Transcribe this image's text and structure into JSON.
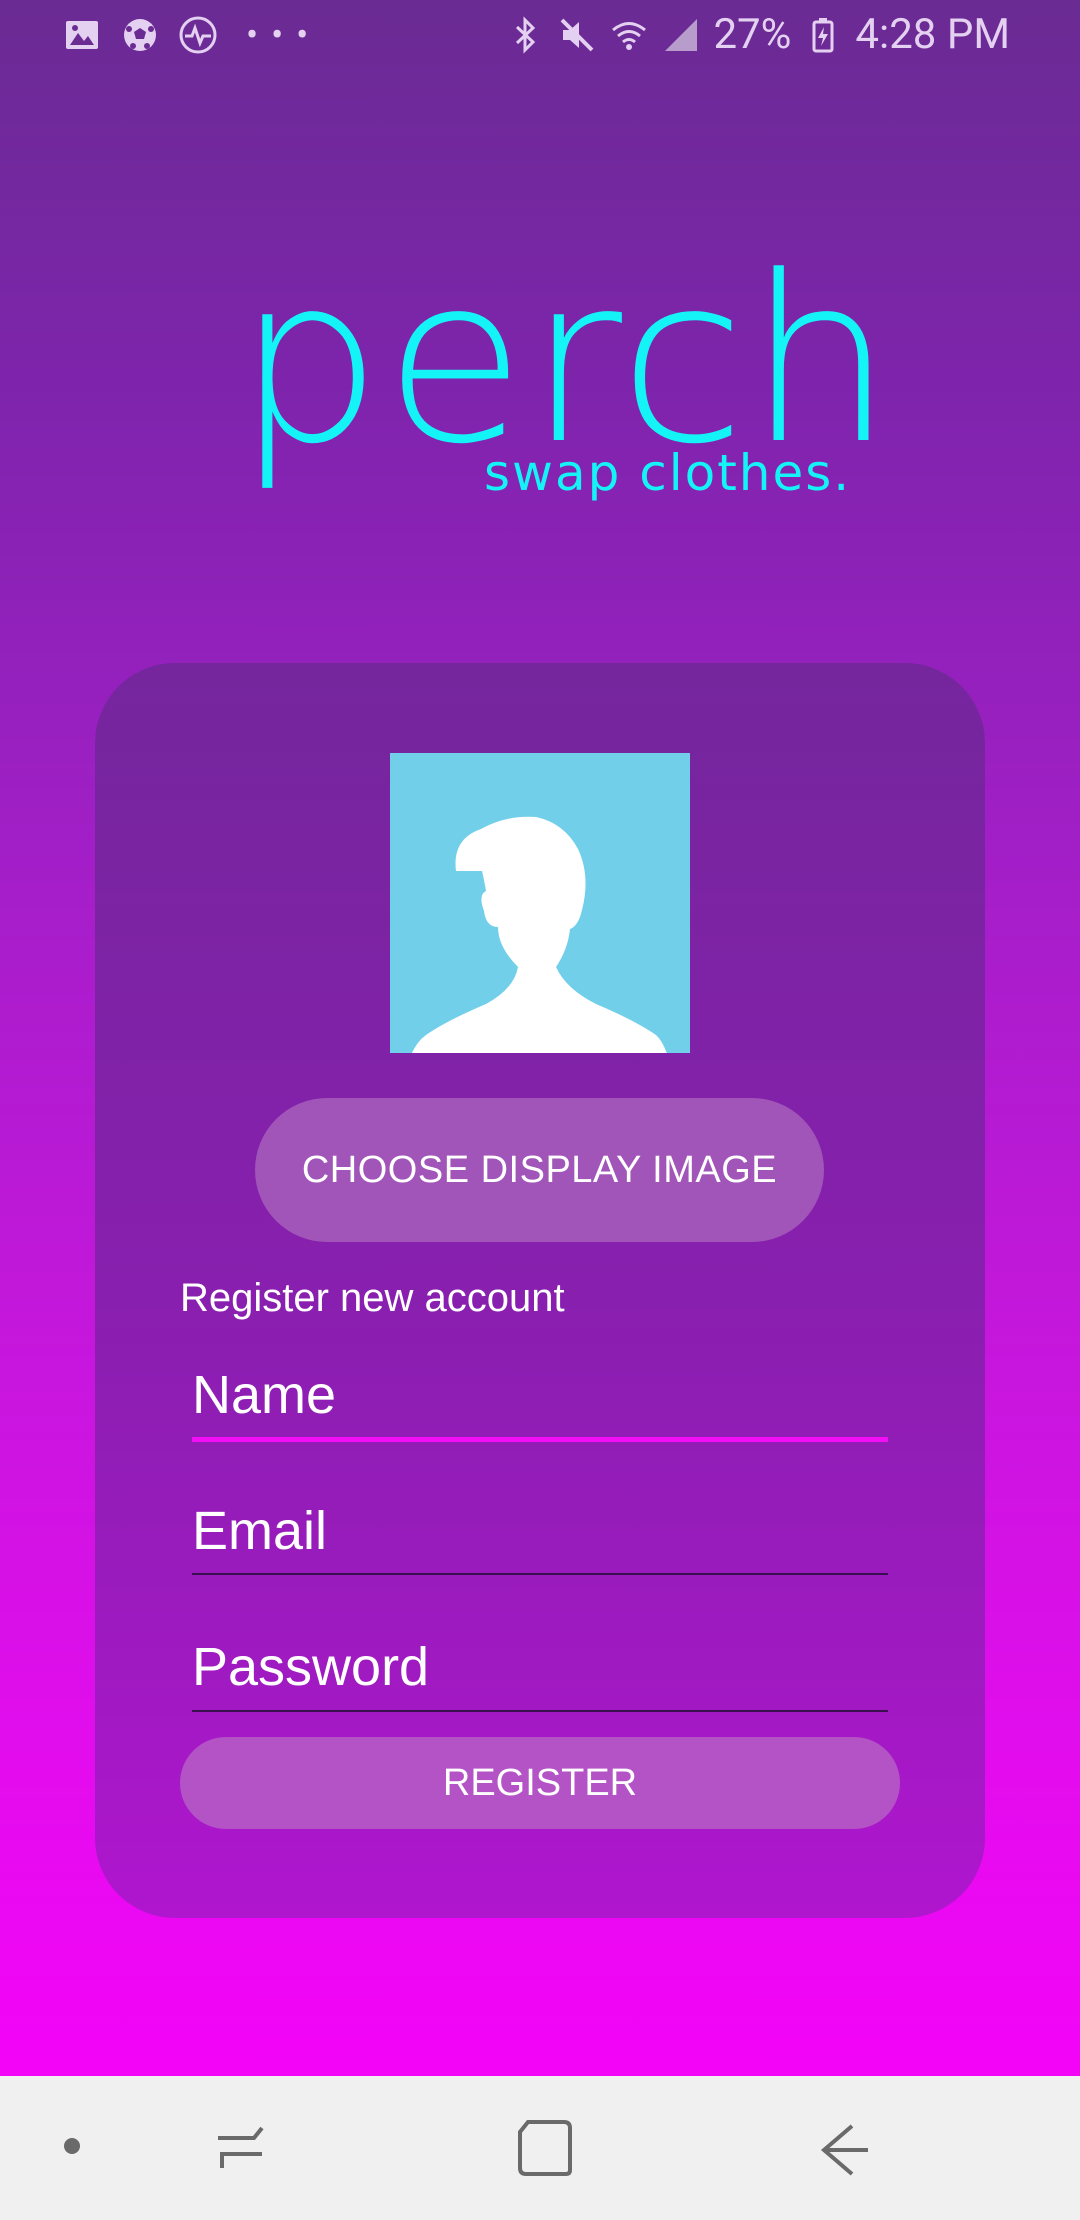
{
  "status_bar": {
    "battery": "27%",
    "time": "4:28 PM",
    "left_icons": [
      "gallery-icon",
      "soccer-ball-icon",
      "health-pulse-icon",
      "more-dots-icon"
    ],
    "right_icons": [
      "bluetooth-icon",
      "mute-icon",
      "wifi-icon",
      "signal-icon",
      "battery-icon"
    ]
  },
  "logo": {
    "word": "perch",
    "tagline": "swap clothes.",
    "color": "#14f4f7"
  },
  "card": {
    "avatar_icon": "person-silhouette-icon",
    "choose_image_label": "CHOOSE DISPLAY IMAGE",
    "register_heading": "Register new account",
    "name_placeholder": "Name",
    "email_placeholder": "Email",
    "password_placeholder": "Password",
    "register_label": "REGISTER"
  },
  "nav_bar": {
    "icons": [
      "nav-dot-icon",
      "recent-apps-icon",
      "home-icon",
      "back-icon"
    ]
  }
}
